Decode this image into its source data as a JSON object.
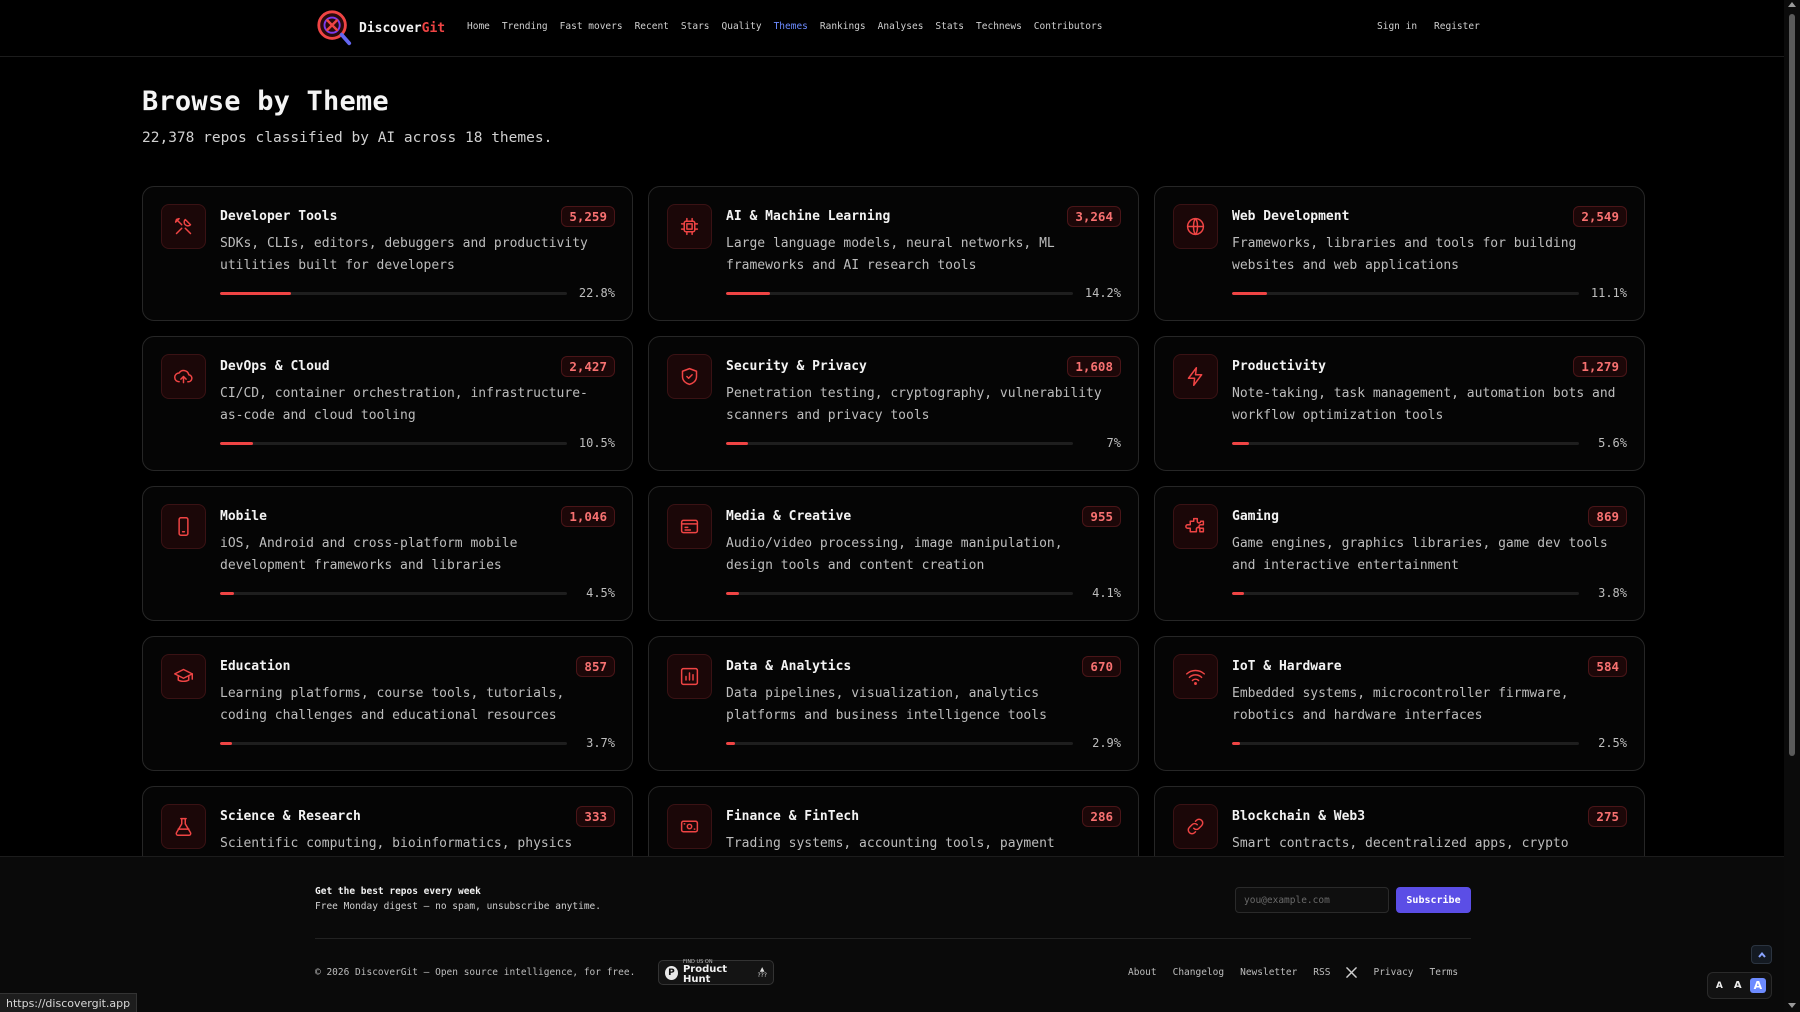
{
  "nav": {
    "logo": {
      "name": "Discover",
      "accent": "Git"
    },
    "links": [
      {
        "label": "Home",
        "active": false
      },
      {
        "label": "Trending",
        "active": false
      },
      {
        "label": "Fast movers",
        "active": false
      },
      {
        "label": "Recent",
        "active": false
      },
      {
        "label": "Stars",
        "active": false
      },
      {
        "label": "Quality",
        "active": false
      },
      {
        "label": "Themes",
        "active": true
      },
      {
        "label": "Rankings",
        "active": false
      },
      {
        "label": "Analyses",
        "active": false
      },
      {
        "label": "Stats",
        "active": false
      },
      {
        "label": "Technews",
        "active": false
      },
      {
        "label": "Contributors",
        "active": false
      }
    ],
    "sign_in": "Sign in",
    "register": "Register"
  },
  "header": {
    "title": "Browse by Theme",
    "subtitle": "22,378 repos classified by AI across 18 themes."
  },
  "themes": [
    {
      "name": "Developer Tools",
      "count": "5,259",
      "desc": "SDKs, CLIs, editors, debuggers and productivity utilities built for developers",
      "pct_label": "22.8%",
      "pct": 22.8,
      "icon": "tools-icon"
    },
    {
      "name": "AI & Machine Learning",
      "count": "3,264",
      "desc": "Large language models, neural networks, ML frameworks and AI research tools",
      "pct_label": "14.2%",
      "pct": 14.2,
      "icon": "chip-icon"
    },
    {
      "name": "Web Development",
      "count": "2,549",
      "desc": "Frameworks, libraries and tools for building websites and web applications",
      "pct_label": "11.1%",
      "pct": 11.1,
      "icon": "globe-icon"
    },
    {
      "name": "DevOps & Cloud",
      "count": "2,427",
      "desc": "CI/CD, container orchestration, infrastructure-as-code and cloud tooling",
      "pct_label": "10.5%",
      "pct": 10.5,
      "icon": "cloud-upload-icon"
    },
    {
      "name": "Security & Privacy",
      "count": "1,608",
      "desc": "Penetration testing, cryptography, vulnerability scanners and privacy tools",
      "pct_label": "7%",
      "pct": 7,
      "icon": "shield-check-icon"
    },
    {
      "name": "Productivity",
      "count": "1,279",
      "desc": "Note-taking, task management, automation bots and workflow optimization tools",
      "pct_label": "5.6%",
      "pct": 5.6,
      "icon": "lightning-icon"
    },
    {
      "name": "Mobile",
      "count": "1,046",
      "desc": "iOS, Android and cross-platform mobile development frameworks and libraries",
      "pct_label": "4.5%",
      "pct": 4.5,
      "icon": "smartphone-icon"
    },
    {
      "name": "Media & Creative",
      "count": "955",
      "desc": "Audio/video processing, image manipulation, design tools and content creation",
      "pct_label": "4.1%",
      "pct": 4.1,
      "icon": "media-icon"
    },
    {
      "name": "Gaming",
      "count": "869",
      "desc": "Game engines, graphics libraries, game dev tools and interactive entertainment",
      "pct_label": "3.8%",
      "pct": 3.8,
      "icon": "puzzle-icon"
    },
    {
      "name": "Education",
      "count": "857",
      "desc": "Learning platforms, course tools, tutorials, coding challenges and educational resources",
      "pct_label": "3.7%",
      "pct": 3.7,
      "icon": "graduation-cap-icon"
    },
    {
      "name": "Data & Analytics",
      "count": "670",
      "desc": "Data pipelines, visualization, analytics platforms and business intelligence tools",
      "pct_label": "2.9%",
      "pct": 2.9,
      "icon": "bar-chart-icon"
    },
    {
      "name": "IoT & Hardware",
      "count": "584",
      "desc": "Embedded systems, microcontroller firmware, robotics and hardware interfaces",
      "pct_label": "2.5%",
      "pct": 2.5,
      "icon": "wifi-icon"
    },
    {
      "name": "Science & Research",
      "count": "333",
      "desc": "Scientific computing, bioinformatics, physics",
      "pct_label": "",
      "pct": null,
      "icon": "flask-icon"
    },
    {
      "name": "Finance & FinTech",
      "count": "286",
      "desc": "Trading systems, accounting tools, payment",
      "pct_label": "",
      "pct": null,
      "icon": "banknote-icon"
    },
    {
      "name": "Blockchain & Web3",
      "count": "275",
      "desc": "Smart contracts, decentralized apps, crypto",
      "pct_label": "",
      "pct": null,
      "icon": "link-icon"
    }
  ],
  "footer": {
    "newsletter_title": "Get the best repos every week",
    "newsletter_sub": "Free Monday digest — no spam, unsubscribe anytime.",
    "email_placeholder": "you@example.com",
    "subscribe_label": "Subscribe",
    "copyright": "© 2026 DiscoverGit — Open source intelligence, for free.",
    "product_hunt_small": "FIND US ON",
    "product_hunt_big": "Product Hunt",
    "product_hunt_votes": "???",
    "links": [
      "About",
      "Changelog",
      "Newsletter",
      "RSS"
    ],
    "links_after_x": [
      "Privacy",
      "Terms"
    ]
  },
  "font_size_toggle": [
    "A",
    "A",
    "A"
  ],
  "status_url": "https://discovergit.app",
  "colors": {
    "accent": "#ef4444",
    "nav_active": "#6d8bff",
    "subscribe": "#5b4ee6"
  }
}
